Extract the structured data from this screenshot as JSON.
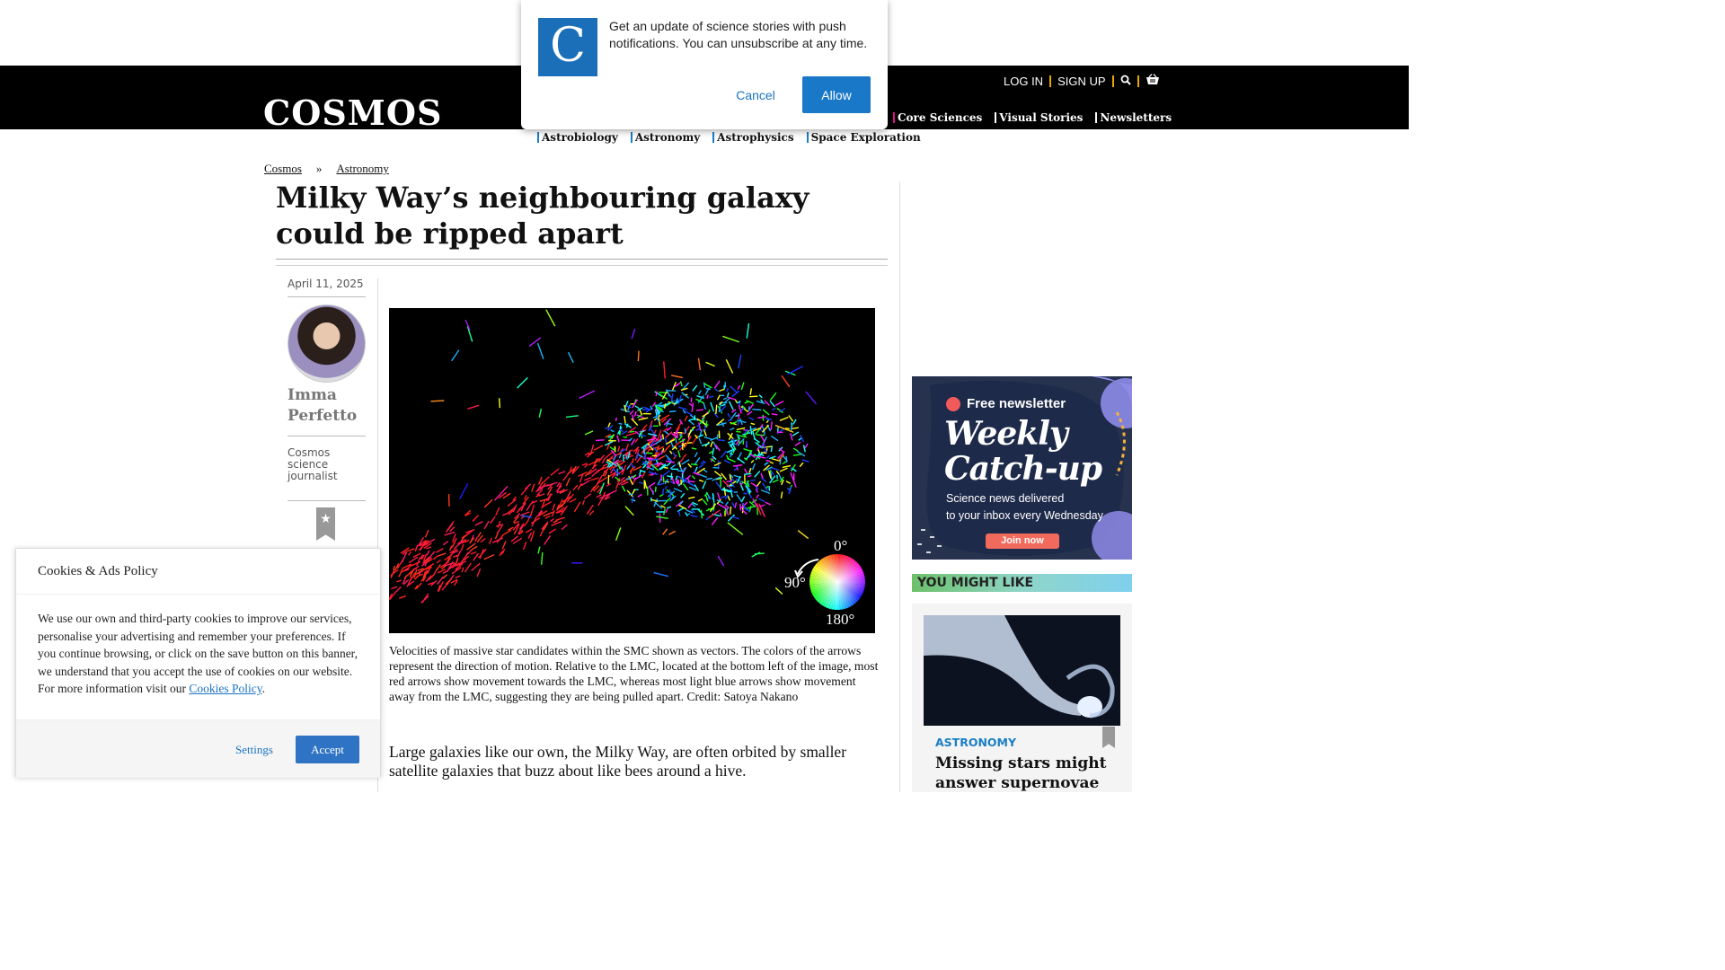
{
  "notification": {
    "message": "Get an update of science stories with push notifications. You can unsubscribe at any time.",
    "cancel_label": "Cancel",
    "allow_label": "Allow",
    "logo_letter": "C"
  },
  "header": {
    "logo": "COSMOS",
    "login": "LOG IN",
    "signup": "SIGN UP",
    "nav": [
      "Core Sciences",
      "Visual Stories",
      "Newsletters"
    ],
    "subnav": [
      "Astrobiology",
      "Astronomy",
      "Astrophysics",
      "Space Exploration"
    ]
  },
  "breadcrumb": {
    "home": "Cosmos",
    "sep": "»",
    "section": "Astronomy"
  },
  "article": {
    "title": "Milky Way’s neighbouring galaxy could be ripped apart",
    "date": "April 11, 2025",
    "author_name": "Imma Perfetto",
    "author_role": "Cosmos science journalist",
    "caption": "Velocities of massive star candidates within the SMC shown as vectors. The colors of the arrows represent the direction of motion. Relative to the LMC, located at the bottom left of the image, most red arrows show movement towards the LMC, whereas most light blue arrows show movement away from the LMC, suggesting they are being pulled apart. Credit: Satoya Nakano",
    "lead": "Large galaxies like our own, the Milky Way, are often orbited by smaller satellite galaxies that buzz about like bees around a hive.",
    "figure_labels": {
      "deg0": "0°",
      "deg90": "90°",
      "deg180": "180°"
    }
  },
  "ad": {
    "free_newsletter": "Free newsletter",
    "title_line1": "Weekly",
    "title_line2": "Catch-up",
    "sub_line1": "Science news delivered",
    "sub_line2": "to your inbox every Wednesday",
    "join": "Join now"
  },
  "sidebar": {
    "you_might_like": "YOU MIGHT LIKE",
    "card_category": "ASTRONOMY",
    "card_headline": "Missing stars might answer supernovae"
  },
  "cookie": {
    "title": "Cookies & Ads Policy",
    "body": "We use our own and third-party cookies to improve our services, personalise your advertising and remember your preferences. If you continue browsing, or click on the save button on this banner, we understand that you accept the use of cookies on our website. For more information visit our",
    "link": "Cookies Policy",
    "settings": "Settings",
    "accept": "Accept"
  },
  "colors": {
    "accent_blue": "#1a78c8",
    "nav_bar": "#000000",
    "link_blue": "#1a73c2"
  }
}
